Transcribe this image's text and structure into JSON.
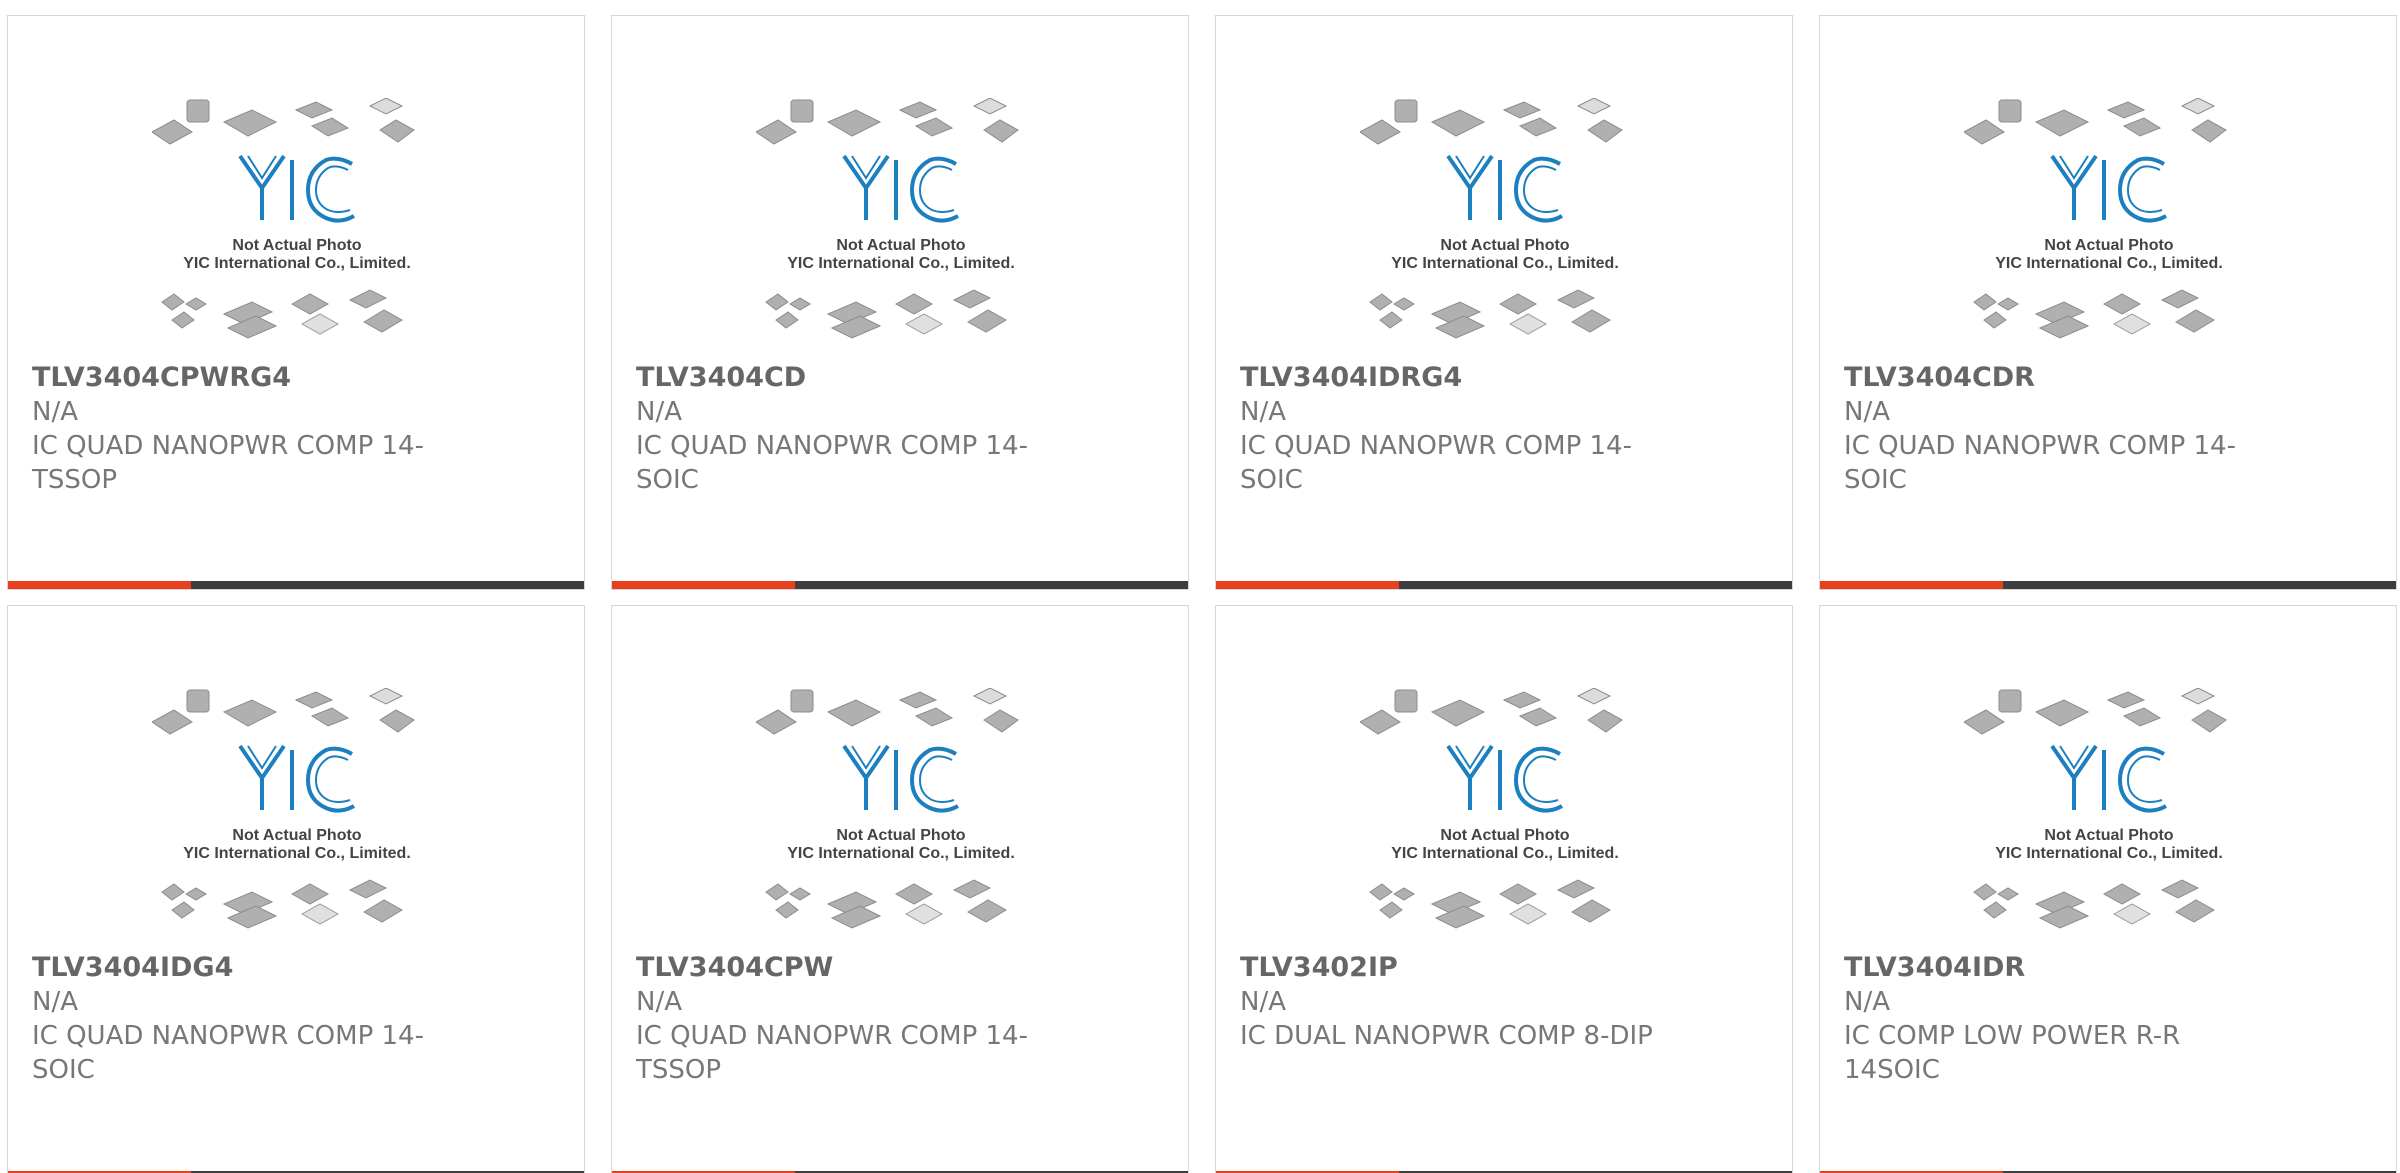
{
  "colors": {
    "accent": "#e8401c",
    "bar_dark": "#3d3d3d",
    "logo_blue": "#1c7fbf",
    "chip_gray": "#a8a8a8"
  },
  "products": [
    {
      "part_number": "TLV3404CPWRG4",
      "manufacturer": "N/A",
      "description": "IC QUAD NANOPWR COMP 14-TSSOP",
      "photo_caption_1": "Not Actual Photo",
      "photo_caption_2": "YIC International Co., Limited.",
      "logo_text": "YIC"
    },
    {
      "part_number": "TLV3404CD",
      "manufacturer": "N/A",
      "description": "IC QUAD NANOPWR COMP 14-SOIC",
      "photo_caption_1": "Not Actual Photo",
      "photo_caption_2": "YIC International Co., Limited.",
      "logo_text": "YIC"
    },
    {
      "part_number": "TLV3404IDRG4",
      "manufacturer": "N/A",
      "description": "IC QUAD NANOPWR COMP 14-SOIC",
      "photo_caption_1": "Not Actual Photo",
      "photo_caption_2": "YIC International Co., Limited.",
      "logo_text": "YIC"
    },
    {
      "part_number": "TLV3404CDR",
      "manufacturer": "N/A",
      "description": "IC QUAD NANOPWR COMP 14-SOIC",
      "photo_caption_1": "Not Actual Photo",
      "photo_caption_2": "YIC International Co., Limited.",
      "logo_text": "YIC"
    },
    {
      "part_number": "TLV3404IDG4",
      "manufacturer": "N/A",
      "description": "IC QUAD NANOPWR COMP 14-SOIC",
      "photo_caption_1": "Not Actual Photo",
      "photo_caption_2": "YIC International Co., Limited.",
      "logo_text": "YIC"
    },
    {
      "part_number": "TLV3404CPW",
      "manufacturer": "N/A",
      "description": "IC QUAD NANOPWR COMP 14-TSSOP",
      "photo_caption_1": "Not Actual Photo",
      "photo_caption_2": "YIC International Co., Limited.",
      "logo_text": "YIC"
    },
    {
      "part_number": "TLV3402IP",
      "manufacturer": "N/A",
      "description": "IC DUAL NANOPWR COMP 8-DIP",
      "photo_caption_1": "Not Actual Photo",
      "photo_caption_2": "YIC International Co., Limited.",
      "logo_text": "YIC"
    },
    {
      "part_number": "TLV3404IDR",
      "manufacturer": "N/A",
      "description": "IC COMP LOW POWER R-R 14SOIC",
      "photo_caption_1": "Not Actual Photo",
      "photo_caption_2": "YIC International Co., Limited.",
      "logo_text": "YIC"
    }
  ]
}
